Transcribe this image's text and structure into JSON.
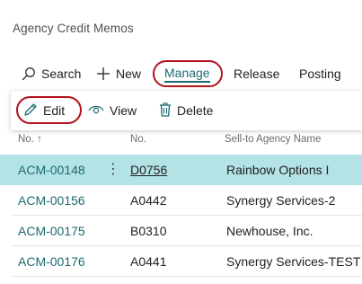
{
  "page": {
    "title": "Agency Credit Memos"
  },
  "actions": {
    "search": {
      "label": "Search",
      "icon": "search-icon"
    },
    "new": {
      "label": "New",
      "icon": "plus-icon"
    },
    "manage": {
      "label": "Manage"
    },
    "release": {
      "label": "Release"
    },
    "posting": {
      "label": "Posting"
    }
  },
  "manage_menu": {
    "edit": {
      "label": "Edit",
      "icon": "pencil-icon"
    },
    "view": {
      "label": "View",
      "icon": "eye-icon"
    },
    "delete": {
      "label": "Delete",
      "icon": "trash-icon"
    }
  },
  "list": {
    "columns": {
      "no": "No. ↑",
      "no2": "No.",
      "name": "Sell-to Agency Name"
    },
    "rows": [
      {
        "no": "ACM-00148",
        "no2": "D0756",
        "name": "Rainbow Options I",
        "selected": true
      },
      {
        "no": "ACM-00156",
        "no2": "A0442",
        "name": "Synergy Services-2",
        "selected": false
      },
      {
        "no": "ACM-00175",
        "no2": "B0310",
        "name": "Newhouse, Inc.",
        "selected": false
      },
      {
        "no": "ACM-00176",
        "no2": "A0441",
        "name": "Synergy Services-TEST",
        "selected": false
      }
    ]
  },
  "colors": {
    "accent": "#1b6b70",
    "selected_row": "#b4e3e6",
    "annotation": "#b3121b"
  }
}
